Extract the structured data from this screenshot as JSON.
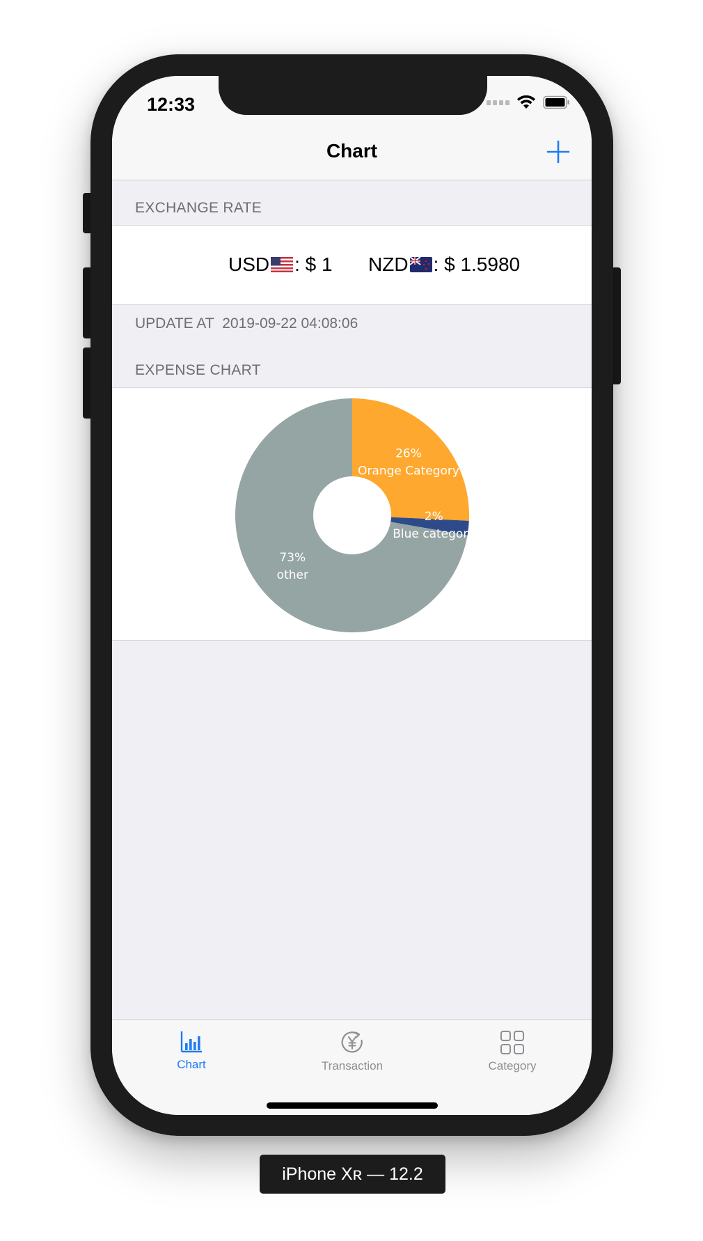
{
  "status_bar": {
    "time": "12:33"
  },
  "nav": {
    "title": "Chart",
    "add_icon": "plus-icon"
  },
  "exchange": {
    "header": "EXCHANGE RATE",
    "usd_code": "USD",
    "usd_value": ": $ 1",
    "nzd_code": "NZD",
    "nzd_value": ": $ 1.5980",
    "update_label": "UPDATE AT",
    "update_time": "2019-09-22 04:08:06"
  },
  "expense": {
    "header": "EXPENSE CHART"
  },
  "chart_data": {
    "type": "pie",
    "donut": true,
    "slices": [
      {
        "label": "Orange Category",
        "percent_label": "26%",
        "value": 26,
        "color": "#fea82f"
      },
      {
        "label": "Blue category",
        "percent_label": "2%",
        "value": 2,
        "color": "#2e4a8b"
      },
      {
        "label": "other",
        "percent_label": "73%",
        "value": 73,
        "color": "#95a5a4"
      }
    ]
  },
  "tabs": [
    {
      "label": "Chart",
      "icon": "bar-chart-icon",
      "active": true
    },
    {
      "label": "Transaction",
      "icon": "yen-cycle-icon",
      "active": false
    },
    {
      "label": "Category",
      "icon": "grid-icon",
      "active": false
    }
  ],
  "colors": {
    "accent": "#1e7cf2",
    "inactive": "#8e8e93",
    "background": "#efeff4"
  },
  "device_label": "iPhone Xʀ — 12.2"
}
